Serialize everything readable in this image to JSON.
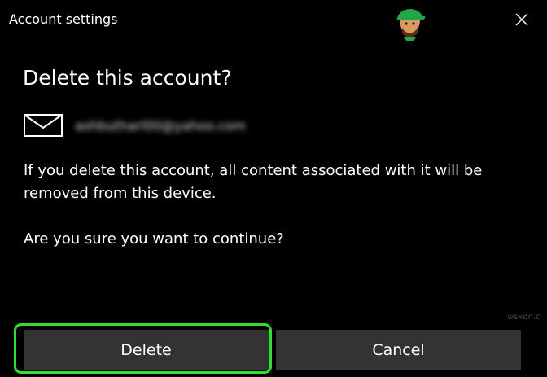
{
  "window": {
    "title": "Account settings",
    "close_icon": "close-icon"
  },
  "dialog": {
    "heading": "Delete this account?",
    "account_icon": "mail-icon",
    "account_email": "ashbutharl00@yahoo.com",
    "message": "If you delete this account, all content associated with it will be removed from this device.",
    "confirm_question": "Are you sure you want to continue?"
  },
  "buttons": {
    "delete_label": "Delete",
    "cancel_label": "Cancel"
  },
  "overlay": {
    "highlight_color": "#33dd33",
    "watermark": "wsxdn.c"
  },
  "colors": {
    "background": "#000000",
    "button_background": "#333333",
    "text": "#ffffff"
  }
}
